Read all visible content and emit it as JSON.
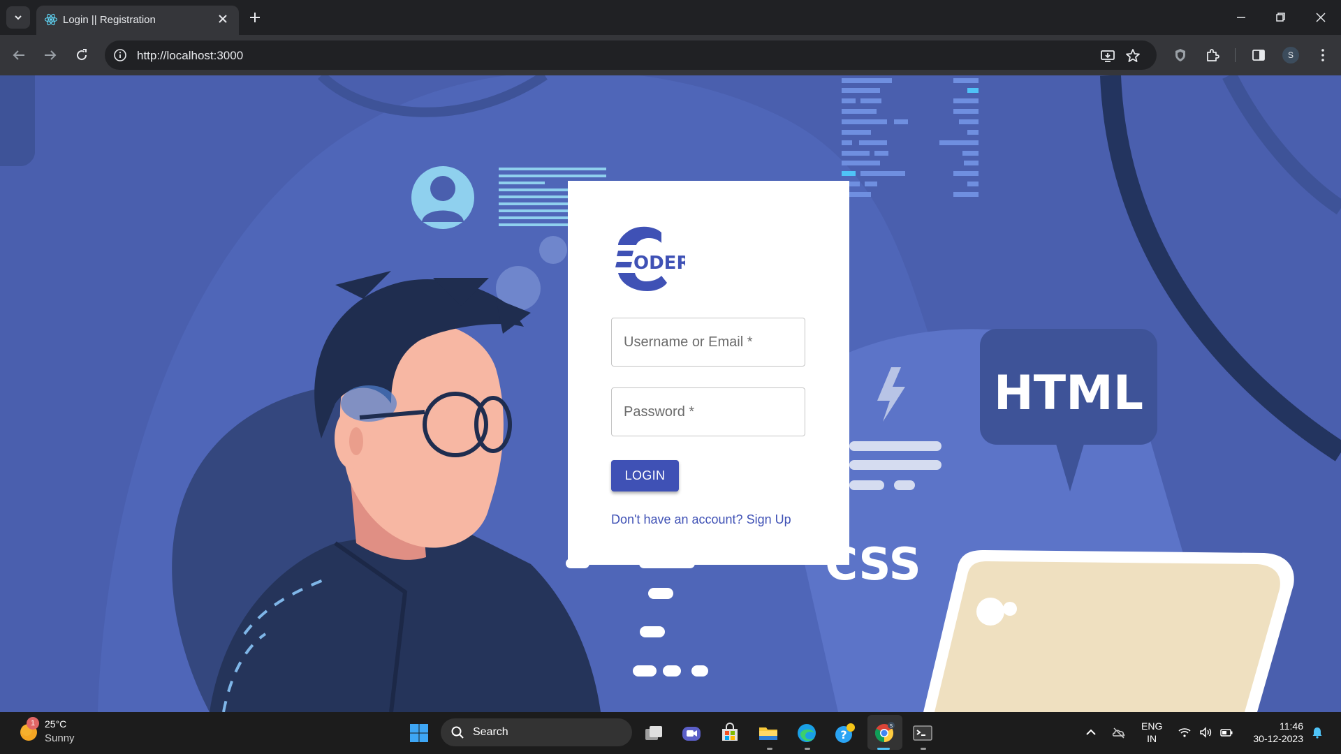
{
  "browser": {
    "tab_title": "Login || Registration",
    "url": "http://localhost:3000",
    "profile_initial": "S"
  },
  "page": {
    "logo_text": "ODER",
    "username_label": "Username or Email",
    "password_label": "Password",
    "required_mark": "*",
    "login_button": "LOGIN",
    "signup_link": "Don't have an account? Sign Up",
    "background_words": {
      "html": "HTML",
      "css": "CSS"
    }
  },
  "taskbar": {
    "weather_temp": "25°C",
    "weather_condition": "Sunny",
    "weather_badge": "1",
    "search_label": "Search",
    "chrome_badge": "S",
    "lang_line1": "ENG",
    "lang_line2": "IN",
    "time": "11:46",
    "date": "30-12-2023"
  },
  "colors": {
    "page_background": "#4a5fae",
    "primary": "#3f51b5",
    "browser_frame": "#202124",
    "browser_toolbar": "#35363a",
    "taskbar": "#1c1c1c"
  }
}
